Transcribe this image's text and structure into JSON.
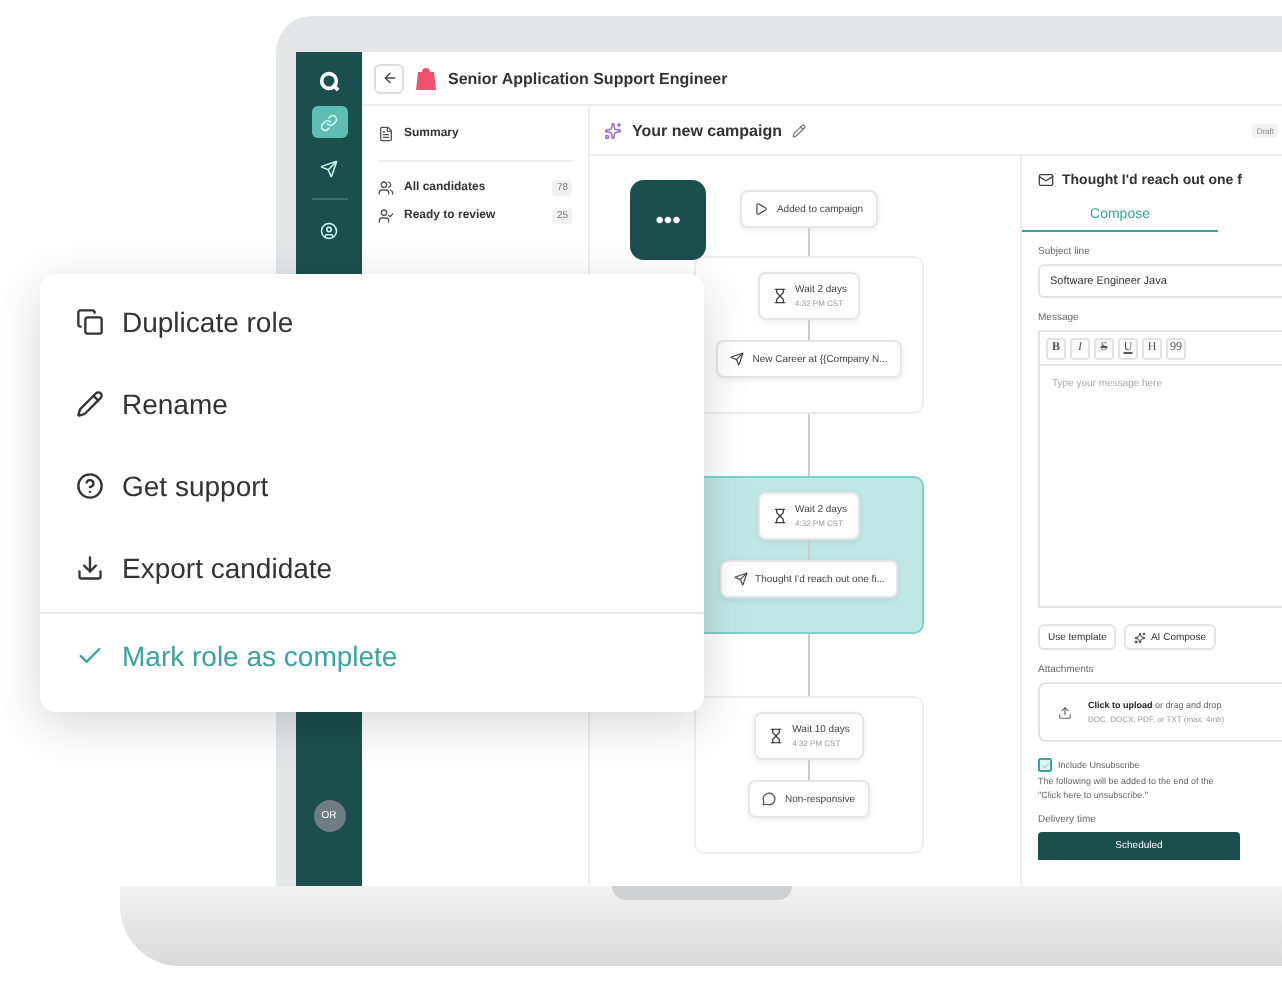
{
  "header": {
    "title": "Senior Application Support Engineer"
  },
  "nav": {
    "items": [
      {
        "selected": true
      },
      {
        "selected": false
      },
      {
        "selected": false
      }
    ],
    "avatar": "OR"
  },
  "sidebar": {
    "summary": "Summary",
    "items": [
      {
        "label": "All candidates",
        "count": "78"
      },
      {
        "label": "Ready to review",
        "count": "25"
      }
    ]
  },
  "campaign": {
    "title": "Your new campaign",
    "status": "Draft"
  },
  "flow": {
    "more_button": "•••",
    "trigger": "Added to campaign",
    "groups": [
      {
        "selected": false,
        "wait": "Wait 2 days",
        "time": "4:32 PM CST",
        "action": {
          "kind": "email",
          "label": "New Career at {{Company N..."
        }
      },
      {
        "selected": true,
        "wait": "Wait 2 days",
        "time": "4:32 PM CST",
        "action": {
          "kind": "email",
          "label": "Thought I'd reach out one fi..."
        }
      },
      {
        "selected": false,
        "wait": "Wait 10 days",
        "time": "4:32 PM CST",
        "action": {
          "kind": "reply",
          "label": "Non-responsive"
        }
      }
    ]
  },
  "email": {
    "title": "Thought I'd reach out one f",
    "tabs": [
      {
        "label": "Compose",
        "selected": true
      }
    ],
    "subject_label": "Subject line",
    "subject": "Software Engineer Java",
    "message_label": "Message",
    "toolbar": [
      "B",
      "I",
      "S",
      "U",
      "H",
      "99"
    ],
    "placeholder": "Type your message here",
    "buttons": [
      "Use template",
      "AI Compose"
    ],
    "attachments_label": "Attachments",
    "upload": "**Click to upload** or drag and drop",
    "upload_hint": "DOC, DOCX, PDF, or TXT (max. 4mb)",
    "unsubscribe": {
      "label": "Include Unsubscribe",
      "checked": true
    },
    "unsubscribe_note": "The following will be added to the end of the",
    "unsubscribe_text": "\"Click here to unsubscribe.\"",
    "delivery_label": "Delivery time",
    "delivery": "Scheduled"
  },
  "menu": [
    {
      "kind": "action",
      "label": "Duplicate role"
    },
    {
      "kind": "action",
      "label": "Rename"
    },
    {
      "kind": "action",
      "label": "Get support"
    },
    {
      "kind": "action",
      "label": "Export candidate"
    },
    {
      "kind": "complete",
      "label": "Mark role as complete"
    }
  ]
}
